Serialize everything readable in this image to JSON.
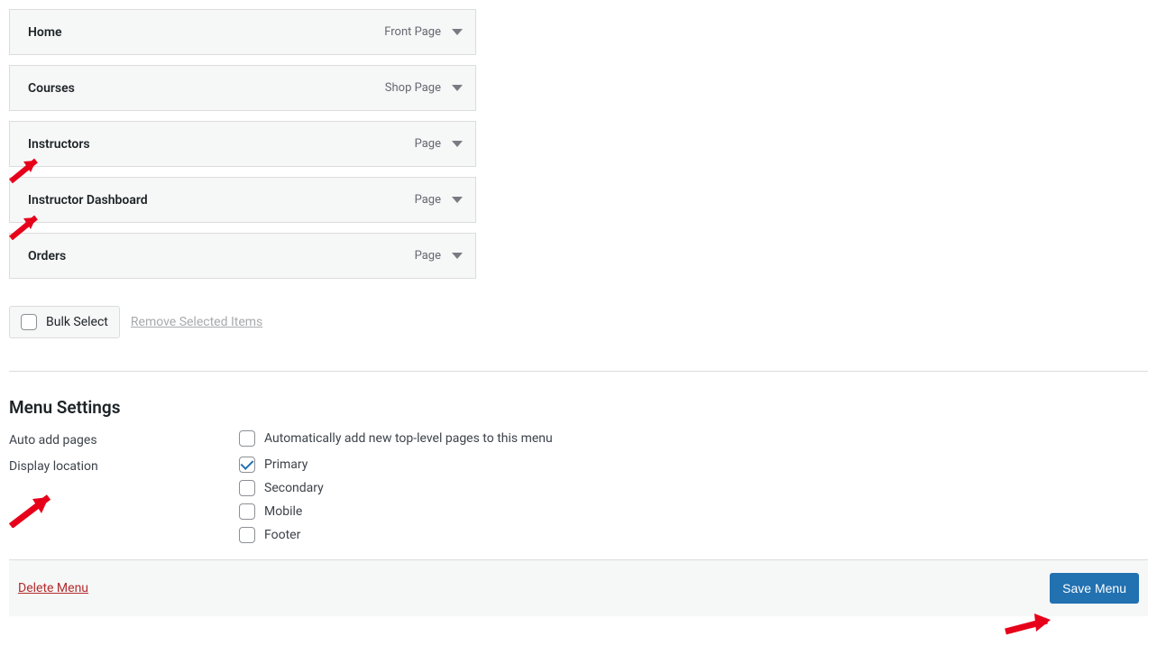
{
  "menu_items": [
    {
      "title": "Home",
      "type": "Front Page"
    },
    {
      "title": "Courses",
      "type": "Shop Page"
    },
    {
      "title": "Instructors",
      "type": "Page"
    },
    {
      "title": "Instructor Dashboard",
      "type": "Page"
    },
    {
      "title": "Orders",
      "type": "Page"
    }
  ],
  "bulk": {
    "select_label": "Bulk Select",
    "remove_label": "Remove Selected Items"
  },
  "settings": {
    "heading": "Menu Settings",
    "auto_add_label": "Auto add pages",
    "auto_add_option": "Automatically add new top-level pages to this menu",
    "display_location_label": "Display location",
    "locations": [
      {
        "label": "Primary",
        "checked": true
      },
      {
        "label": "Secondary",
        "checked": false
      },
      {
        "label": "Mobile",
        "checked": false
      },
      {
        "label": "Footer",
        "checked": false
      }
    ]
  },
  "footer": {
    "delete_label": "Delete Menu",
    "save_label": "Save Menu"
  }
}
